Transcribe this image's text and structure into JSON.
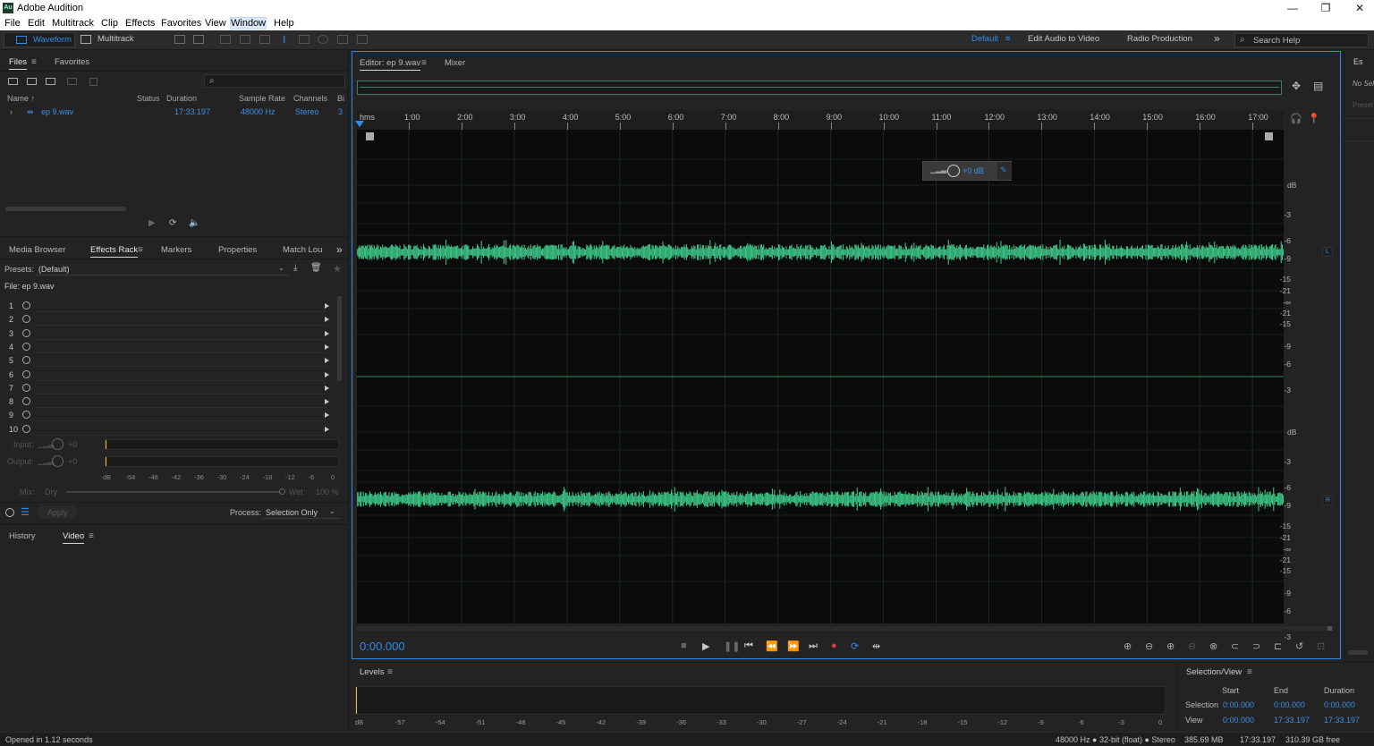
{
  "window": {
    "app_icon": "Au",
    "title": "Adobe Audition",
    "minimize": "—",
    "maximize": "❐",
    "close": "✕"
  },
  "menu": [
    "File",
    "Edit",
    "Multitrack",
    "Clip",
    "Effects",
    "Favorites",
    "View",
    "Window",
    "Help"
  ],
  "toolbar": {
    "waveform": "Waveform",
    "multitrack": "Multitrack",
    "workspaces": [
      "Default",
      "Edit Audio to Video",
      "Radio Production"
    ],
    "more": "»",
    "search_placeholder": "Search Help"
  },
  "files_panel": {
    "tabs": [
      "Files",
      "Favorites"
    ],
    "columns": [
      "Name ↑",
      "Status",
      "Duration",
      "Sample Rate",
      "Channels",
      "Bi"
    ],
    "file": {
      "name": "ep 9.wav",
      "status": "",
      "duration": "17:33.197",
      "sample_rate": "48000 Hz",
      "channels": "Stereo",
      "bits": "3"
    }
  },
  "effects_panel": {
    "tabs": [
      "Media Browser",
      "Effects Rack",
      "Markers",
      "Properties",
      "Match Lou"
    ],
    "more": "»",
    "presets_label": "Presets:",
    "presets_value": "(Default)",
    "file_label": "File: ep 9.wav",
    "slots": [
      "1",
      "2",
      "3",
      "4",
      "5",
      "6",
      "7",
      "8",
      "9",
      "10"
    ],
    "input_label": "Input:",
    "input_value": "+0",
    "output_label": "Output:",
    "output_value": "+0",
    "meter_scale": [
      "dB",
      "-54",
      "-48",
      "-42",
      "-36",
      "-30",
      "-24",
      "-18",
      "-12",
      "-6",
      "0"
    ],
    "mix_label": "Mix:",
    "mix_dry": "Dry",
    "mix_wet": "Wet",
    "mix_value": "100 %",
    "apply": "Apply",
    "process_label": "Process:",
    "process_value": "Selection Only"
  },
  "history_panel": {
    "tabs": [
      "History",
      "Video"
    ]
  },
  "editor": {
    "tab_label": "Editor: ep 9.wav",
    "mixer_tab": "Mixer",
    "ruler_unit": "hms",
    "ruler": [
      "1:00",
      "2:00",
      "3:00",
      "4:00",
      "5:00",
      "6:00",
      "7:00",
      "8:00",
      "9:00",
      "10:00",
      "11:00",
      "12:00",
      "13:00",
      "14:00",
      "15:00",
      "16:00",
      "17:00"
    ],
    "hud_gain": "+0 dB",
    "db_scale_top": [
      "dB",
      "-3",
      "-6",
      "-9",
      "-15",
      "-21",
      "-∞",
      "-21",
      "-15",
      "-9",
      "-6",
      "-3"
    ],
    "db_scale_bottom": [
      "dB",
      "-3",
      "-6",
      "-9",
      "-15",
      "-21",
      "-∞",
      "-21",
      "-15",
      "-9",
      "-6",
      "-3"
    ],
    "channel_l": "L",
    "channel_r": "R",
    "timecode": "0:00.000",
    "waveform_color": "#3ecf8e"
  },
  "levels_panel": {
    "title": "Levels",
    "scale": [
      "dB",
      "-57",
      "-54",
      "-51",
      "-48",
      "-45",
      "-42",
      "-39",
      "-36",
      "-33",
      "-30",
      "-27",
      "-24",
      "-21",
      "-18",
      "-15",
      "-12",
      "-9",
      "-6",
      "-3",
      "0"
    ]
  },
  "selection_view": {
    "title": "Selection/View",
    "headers": [
      "Start",
      "End",
      "Duration"
    ],
    "rows": [
      {
        "label": "Selection",
        "start": "0:00.000",
        "end": "0:00.000",
        "duration": "0:00.000"
      },
      {
        "label": "View",
        "start": "0:00.000",
        "end": "17:33.197",
        "duration": "17:33.197"
      }
    ]
  },
  "right_panel": {
    "tab": "Es",
    "text1": "No Sel",
    "text2": "Preset"
  },
  "status": {
    "left": "Opened in 1.12 seconds",
    "format": "48000 Hz ● 32-bit (float) ● Stereo",
    "size": "385.69 MB",
    "duration": "17:33.197",
    "free": "310.39 GB free"
  }
}
